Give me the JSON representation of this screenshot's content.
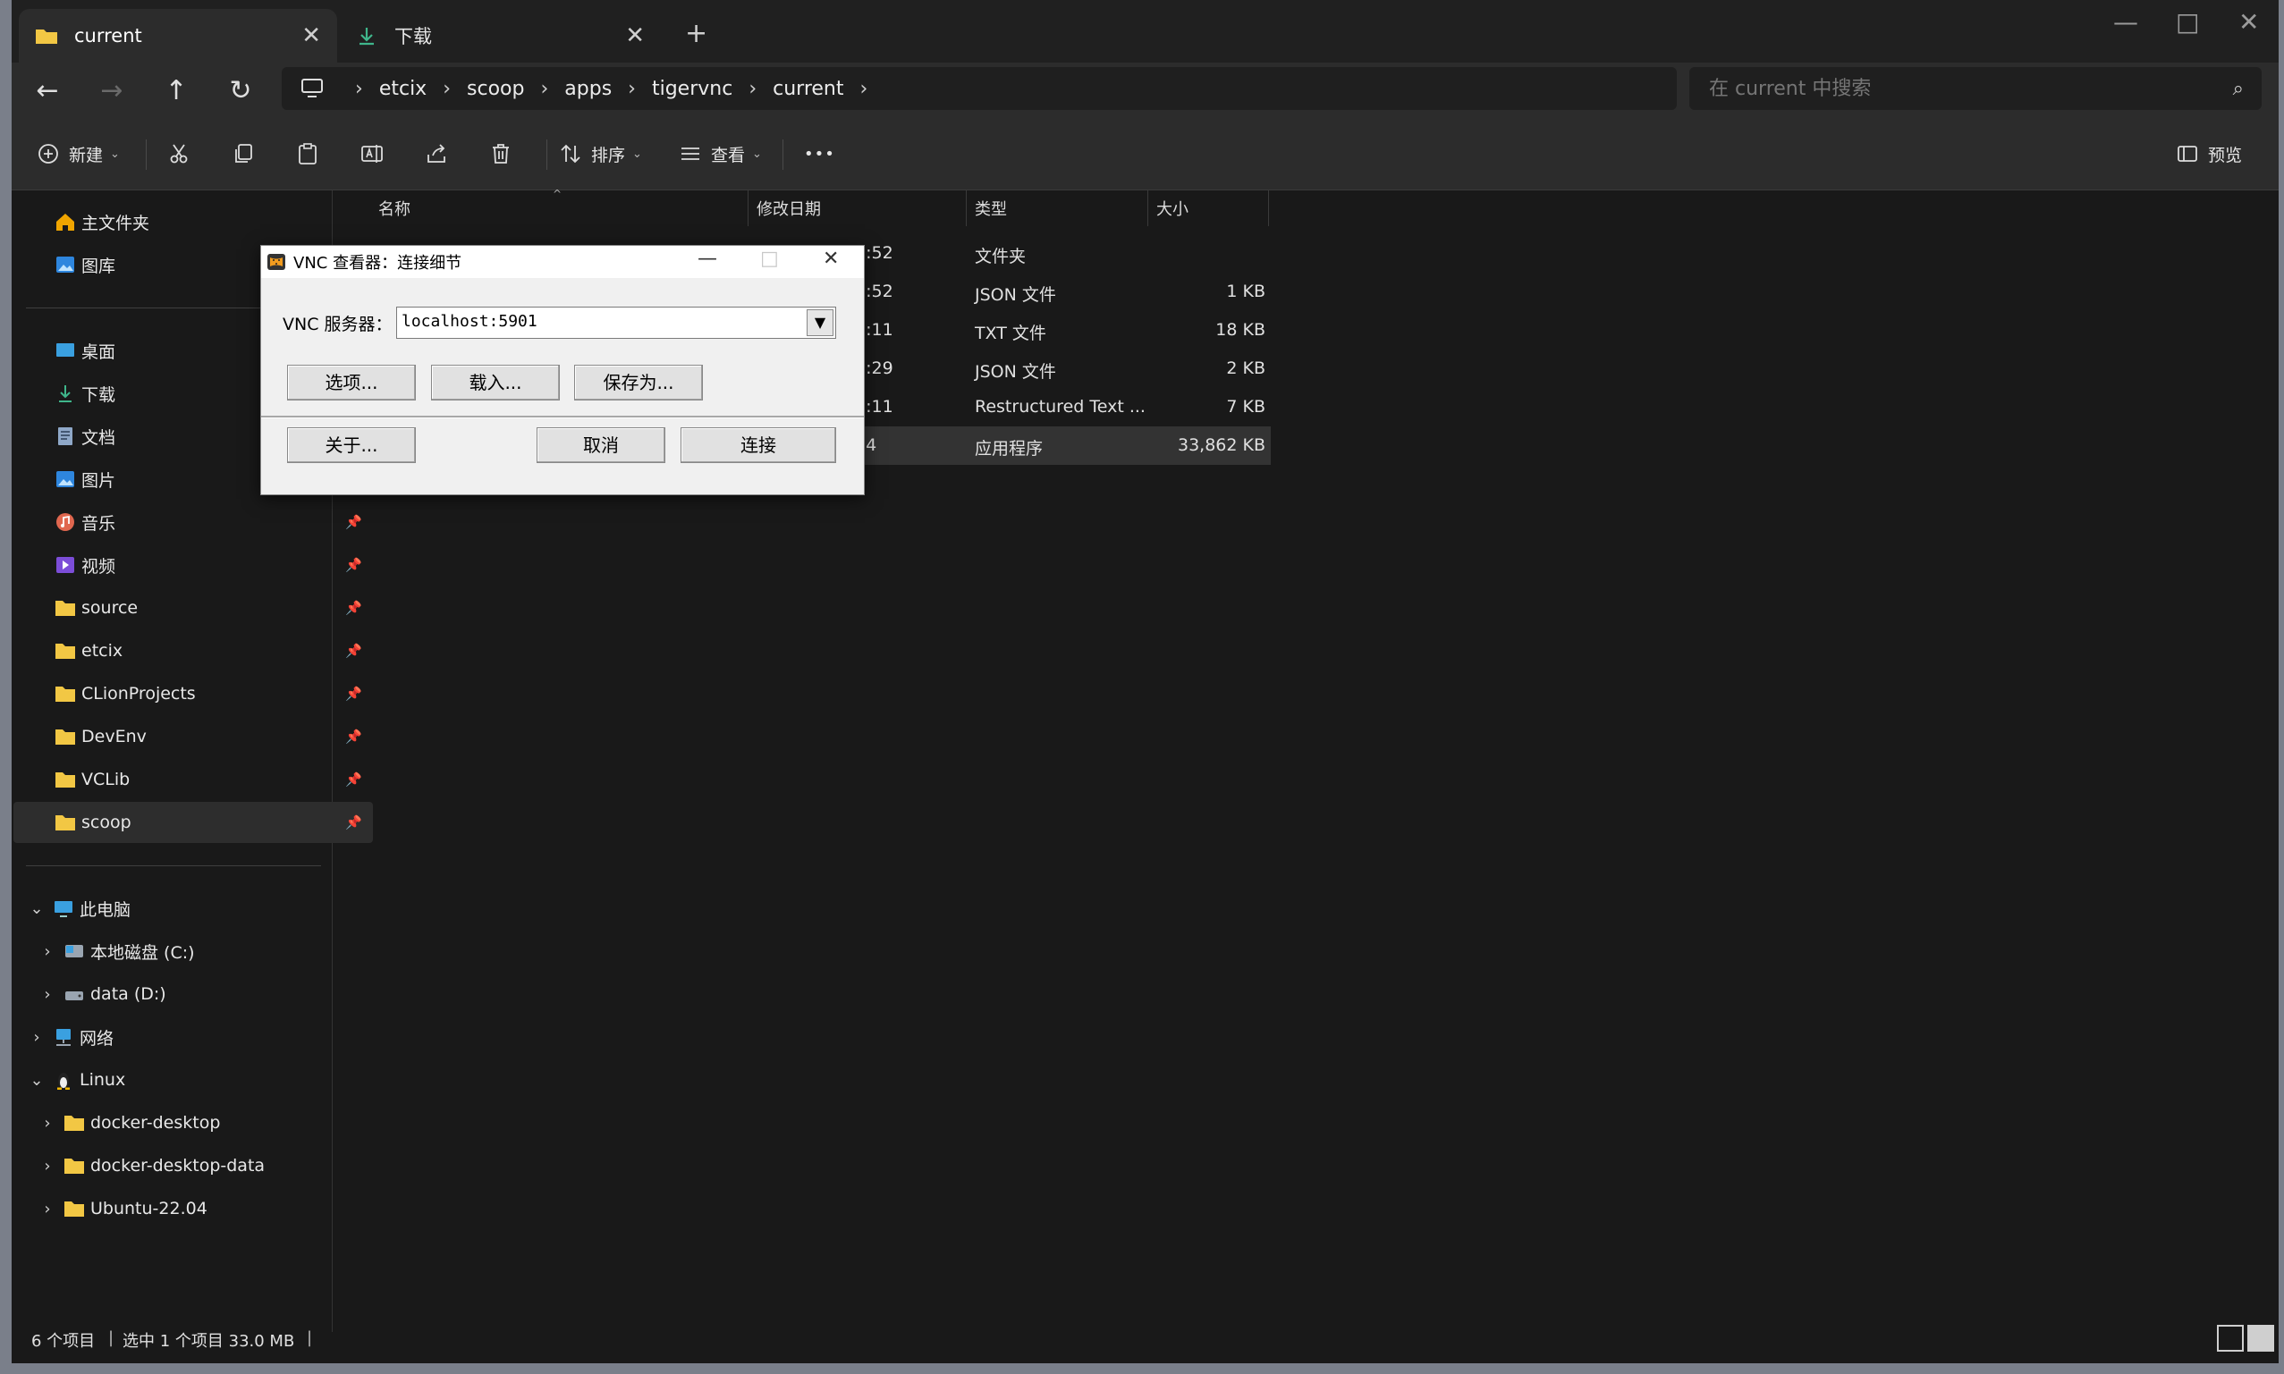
{
  "tabs": [
    {
      "label": "current",
      "active": true
    },
    {
      "label": "下载",
      "active": false
    }
  ],
  "icons": {
    "new_tab": "+",
    "minimize": "—",
    "maximize": "□",
    "close": "✕",
    "tab_close": "✕",
    "back": "←",
    "forward": "→",
    "up": "↑",
    "refresh": "↻",
    "search": "⌕",
    "breadcrumb_sep": "›",
    "more": "•••",
    "pin": "📌",
    "expand": "›",
    "collapse": "⌄",
    "chevron": "⌄",
    "sort_asc": "^",
    "dropdown": "▼",
    "dlg_minimize": "—",
    "dlg_maximize": "□",
    "dlg_close": "✕"
  },
  "breadcrumb": [
    "etcix",
    "scoop",
    "apps",
    "tigervnc",
    "current"
  ],
  "search": {
    "placeholder": "在 current 中搜索"
  },
  "toolbar": {
    "new_label": "新建",
    "sort_label": "排序",
    "view_label": "查看",
    "preview_label": "预览"
  },
  "sidebar": {
    "quick": [
      {
        "label": "主文件夹",
        "icon": "home-icon"
      },
      {
        "label": "图库",
        "icon": "gallery-icon"
      }
    ],
    "pinned": [
      {
        "label": "桌面",
        "icon": "desktop-icon"
      },
      {
        "label": "下载",
        "icon": "download-icon"
      },
      {
        "label": "文档",
        "icon": "document-icon"
      },
      {
        "label": "图片",
        "icon": "pictures-icon"
      },
      {
        "label": "音乐",
        "icon": "music-icon"
      },
      {
        "label": "视频",
        "icon": "video-icon"
      },
      {
        "label": "source",
        "icon": "folder-icon"
      },
      {
        "label": "etcix",
        "icon": "folder-icon"
      },
      {
        "label": "CLionProjects",
        "icon": "folder-icon"
      },
      {
        "label": "DevEnv",
        "icon": "folder-icon"
      },
      {
        "label": "VCLib",
        "icon": "folder-icon"
      },
      {
        "label": "scoop",
        "icon": "folder-icon"
      }
    ],
    "tree": [
      {
        "label": "此电脑",
        "icon": "pc-icon"
      },
      {
        "label": "本地磁盘 (C:)",
        "icon": "drive-c-icon"
      },
      {
        "label": "data (D:)",
        "icon": "drive-d-icon"
      },
      {
        "label": "网络",
        "icon": "network-icon"
      },
      {
        "label": "Linux",
        "icon": "linux-icon"
      },
      {
        "label": "docker-desktop",
        "icon": "folder-icon"
      },
      {
        "label": "docker-desktop-data",
        "icon": "folder-icon"
      },
      {
        "label": "Ubuntu-22.04",
        "icon": "folder-icon"
      }
    ]
  },
  "file_list": {
    "columns": [
      "名称",
      "修改日期",
      "类型",
      "大小"
    ],
    "rows": [
      {
        "date": "1:52",
        "type": "文件夹",
        "size": ""
      },
      {
        "date": "1:52",
        "type": "JSON 文件",
        "size": "1 KB"
      },
      {
        "date": "5:11",
        "type": "TXT 文件",
        "size": "18 KB"
      },
      {
        "date": "3:29",
        "type": "JSON 文件",
        "size": "2 KB"
      },
      {
        "date": "5:11",
        "type": "Restructured Text ...",
        "size": "7 KB"
      },
      {
        "date": "24",
        "type": "应用程序",
        "size": "33,862 KB"
      }
    ]
  },
  "status": {
    "count": "6 个项目",
    "selection": "选中 1 个项目  33.0 MB"
  },
  "vnc_dialog": {
    "title": "VNC 查看器：连接细节",
    "server_label": "VNC 服务器：",
    "server_value": "localhost:5901",
    "options_button": "选项...",
    "load_button": "载入...",
    "save_button": "保存为...",
    "about_button": "关于...",
    "cancel_button": "取消",
    "connect_button": "连接"
  }
}
